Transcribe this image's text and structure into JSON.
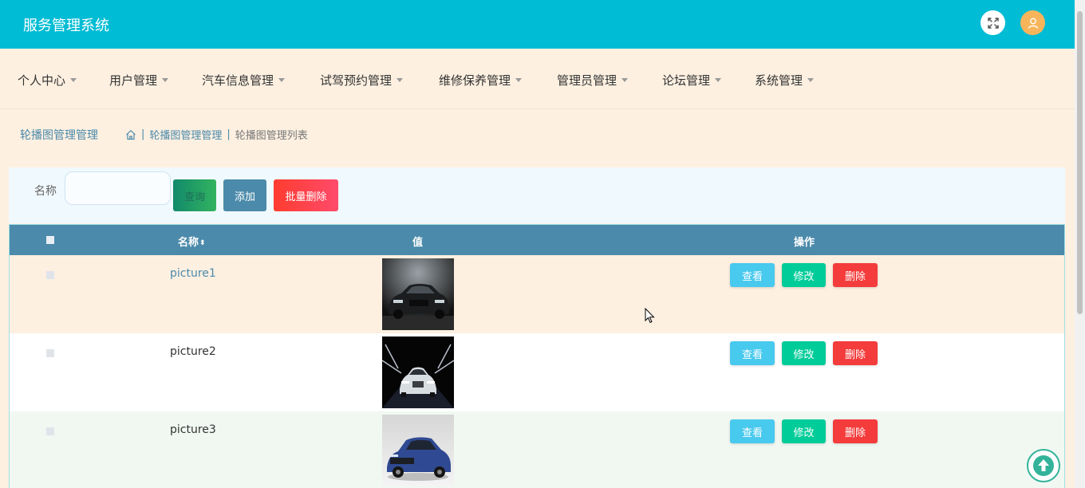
{
  "header": {
    "app_title": "服务管理系统",
    "fullscreen_icon": "expand-icon",
    "user_icon": "user-icon"
  },
  "menu": [
    {
      "label": "个人中心"
    },
    {
      "label": "用户管理"
    },
    {
      "label": "汽车信息管理"
    },
    {
      "label": "试驾预约管理"
    },
    {
      "label": "维修保养管理"
    },
    {
      "label": "管理员管理"
    },
    {
      "label": "论坛管理"
    },
    {
      "label": "系统管理"
    }
  ],
  "breadcrumb": {
    "title": "轮播图管理管理",
    "home_icon": "home-icon",
    "items": [
      "轮播图管理管理",
      "轮播图管理列表"
    ],
    "separator": "|"
  },
  "search": {
    "label": "名称",
    "value": "",
    "placeholder": "",
    "query_label": "查询",
    "add_label": "添加",
    "batch_delete_label": "批量删除"
  },
  "table": {
    "columns": {
      "name": "名称",
      "value": "值",
      "actions": "操作"
    },
    "rows": [
      {
        "name": "picture1",
        "image": "black-sedan-car",
        "bg": "#fdf0e1",
        "highlighted": true
      },
      {
        "name": "picture2",
        "image": "white-suv-headlights",
        "bg": "#ffffff",
        "highlighted": false
      },
      {
        "name": "picture3",
        "image": "blue-suv",
        "bg": "#f1f8f2",
        "highlighted": false
      }
    ],
    "actions": {
      "view": "查看",
      "edit": "修改",
      "delete": "删除"
    }
  },
  "colors": {
    "topbar": "#00bcd4",
    "table_header": "#4b8aaa",
    "view": "#48c9ee",
    "edit": "#00cc99",
    "delete": "#f43c3c"
  }
}
